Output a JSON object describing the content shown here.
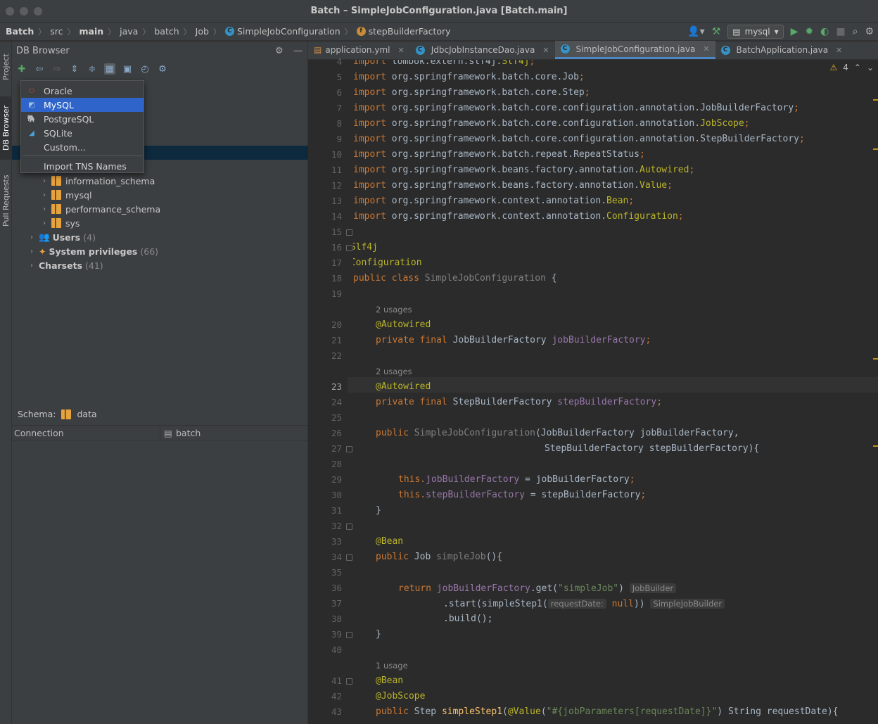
{
  "window": {
    "title": "Batch – SimpleJobConfiguration.java [Batch.main]"
  },
  "breadcrumbs": [
    "Batch",
    "src",
    "main",
    "java",
    "batch",
    "Job",
    "SimpleJobConfiguration",
    "stepBuilderFactory"
  ],
  "run_config": "mysql",
  "side_tabs": [
    "Project",
    "DB Browser",
    "Pull Requests"
  ],
  "panel": {
    "title": "DB Browser"
  },
  "db_menu": {
    "items": [
      "Oracle",
      "MySQL",
      "PostgreSQL",
      "SQLite",
      "Custom..."
    ],
    "selected": "MySQL",
    "import_label": "Import TNS Names"
  },
  "tree": {
    "schemas": [
      "information_schema",
      "mysql",
      "performance_schema",
      "sys"
    ],
    "groups": [
      {
        "label": "Users",
        "count": "(4)"
      },
      {
        "label": "System privileges",
        "count": "(66)"
      },
      {
        "label": "Charsets",
        "count": "(41)"
      }
    ]
  },
  "schema_bar": {
    "label": "Schema:",
    "value": "data"
  },
  "properties": {
    "key": "Connection",
    "value": "batch"
  },
  "tabs": [
    "application.yml",
    "JdbcJobInstanceDao.java",
    "SimpleJobConfiguration.java",
    "BatchApplication.java"
  ],
  "active_tab": "SimpleJobConfiguration.java",
  "warnings": "4",
  "line_numbers": [
    "4",
    "5",
    "6",
    "7",
    "8",
    "9",
    "10",
    "11",
    "12",
    "13",
    "14",
    "15",
    "16",
    "17",
    "18",
    "19",
    "20",
    "21",
    "22",
    "23",
    "24",
    "25",
    "26",
    "27",
    "28",
    "29",
    "30",
    "31",
    "32",
    "33",
    "34",
    "35",
    "36",
    "37",
    "38",
    "39",
    "40",
    "41",
    "42",
    "43"
  ],
  "usages": [
    "2 usages",
    "2 usages",
    "1 usage"
  ],
  "code": {
    "l4a": "import ",
    "l4b": "lombok.extern.slf4j.",
    "l4c": "Slf4j",
    ";": ";",
    "l5": "org.springframework.batch.core.Job",
    "l6": "org.springframework.batch.core.Step",
    "l7": "org.springframework.batch.core.configuration.annotation.JobBuilderFactory",
    "l8a": "org.springframework.batch.core.configuration.annotation.",
    "l8b": "JobScope",
    "l9": "org.springframework.batch.core.configuration.annotation.StepBuilderFactory",
    "l10": "org.springframework.batch.repeat.RepeatStatus",
    "l11a": "org.springframework.beans.factory.annotation.",
    "l11b": "Autowired",
    "l12a": "org.springframework.beans.factory.annotation.",
    "l12b": "Value",
    "l13a": "org.springframework.context.annotation.",
    "l13b": "Bean",
    "l14a": "org.springframework.context.annotation.",
    "l14b": "Configuration",
    "l16": "@Slf4j",
    "l17": "@Configuration",
    "l18a": "public class ",
    "l18b": "SimpleJobConfiguration",
    " {": " {",
    "l20": "@Autowired",
    "l21a": "private final ",
    "l21b": "JobBuilderFactory ",
    "l21c": "jobBuilderFactory",
    "l23": "@Autowired",
    "l24a": "private final ",
    "l24b": "StepBuilderFactory ",
    "l24c": "stepBuilderFactory",
    "l26a": "public ",
    "l26b": "SimpleJobConfiguration",
    "l26c": "(JobBuilderFactory jobBuilderFactory,",
    "l27": "StepBuilderFactory stepBuilderFactory){",
    "l29a": "this.",
    "l29b": "jobBuilderFactory",
    "l29c": " = jobBuilderFactory",
    "l30a": "this.",
    "l30b": "stepBuilderFactory",
    "l30c": " = stepBuilderFactory",
    "l31": "}",
    "l33": "@Bean",
    "l34a": "public ",
    "l34b": "Job ",
    "l34c": "simpleJob",
    "l34d": "(){",
    "l36a": "return ",
    "l36b": "jobBuilderFactory",
    "l36c": ".get(",
    "l36d": "\"simpleJob\"",
    "l36e": ")",
    "l36h": "JobBuilder",
    "l37a": ".start(simpleStep1(",
    "l37h": "requestDate:",
    "l37b": "null",
    "l37c": "))",
    "l37t": "SimpleJobBuilder",
    "l38": ".build();",
    "l39": "}",
    "l41": "@Bean",
    "l42": "@JobScope",
    "l43a": "public ",
    "l43b": "Step ",
    "l43c": "simpleStep1",
    "l43d": "(",
    "l43e": "@Value",
    "l43f": "(",
    "l43g": "\"#{jobParameters[requestDate]}\"",
    "l43i": ") String requestDate){"
  }
}
